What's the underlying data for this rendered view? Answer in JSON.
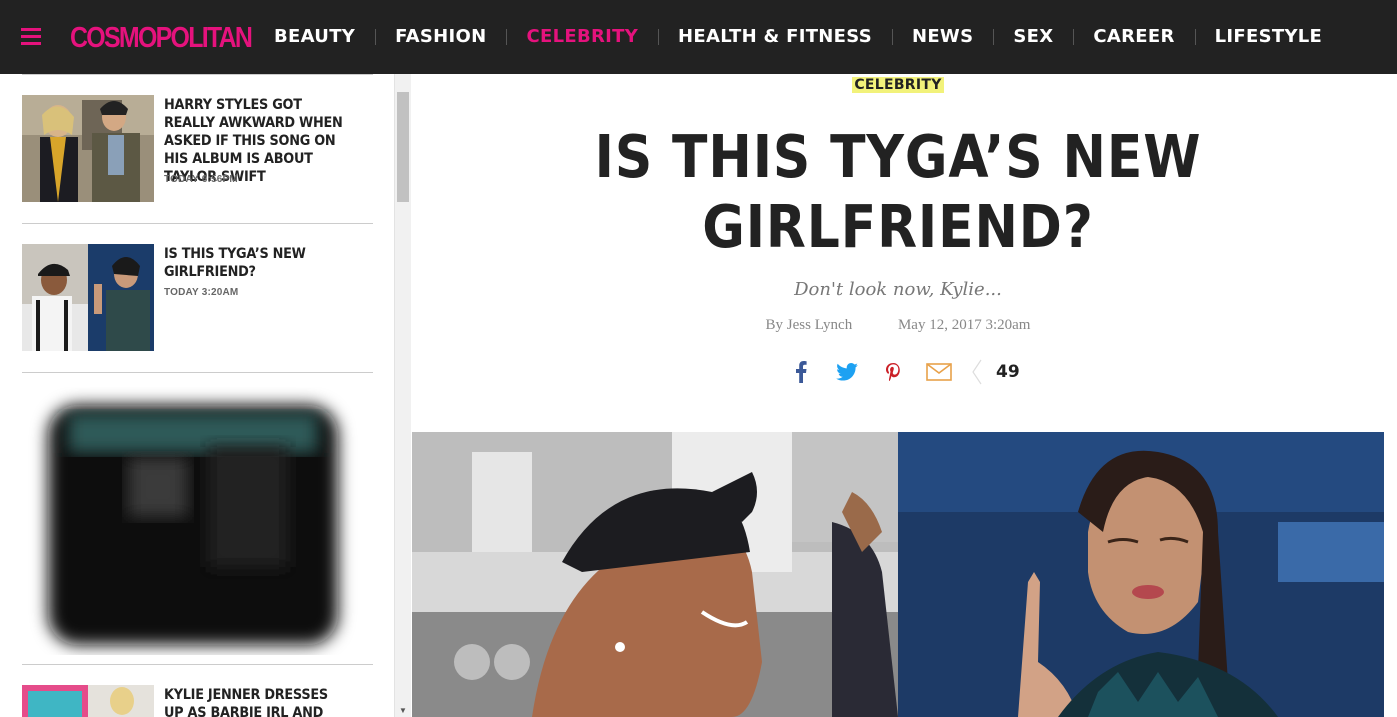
{
  "header": {
    "logo": "COSMOPOLITAN",
    "nav": [
      "BEAUTY",
      "FASHION",
      "CELEBRITY",
      "HEALTH & FITNESS",
      "NEWS",
      "SEX",
      "CAREER",
      "LIFESTYLE"
    ],
    "active": "CELEBRITY"
  },
  "sidebar": {
    "items": [
      {
        "title": "HARRY STYLES GOT REALLY AWKWARD WHEN ASKED IF THIS SONG ON HIS ALBUM IS ABOUT TAYLOR SWIFT",
        "time": "TODAY 6:56PM"
      },
      {
        "title": "IS THIS TYGA’S NEW GIRLFRIEND?",
        "time": "TODAY 3:20AM"
      },
      {
        "title": "KYLIE JENNER DRESSES UP AS BARBIE IRL AND THE PICS ARE",
        "time": ""
      }
    ]
  },
  "article": {
    "section": "CELEBRITY",
    "headline_line1": "IS THIS TYGA’S NEW",
    "headline_line2": "GIRLFRIEND?",
    "dek": "Don't look now, Kylie...",
    "author": "By Jess Lynch",
    "date": "May 12, 2017 3:20am",
    "share_count": "49"
  },
  "icons": {
    "facebook": "facebook-icon",
    "twitter": "twitter-icon",
    "pinterest": "pinterest-icon",
    "email": "email-icon"
  },
  "colors": {
    "brand": "#e5127d",
    "nav_bg": "#222222",
    "section_highlight": "#f2f27a",
    "facebook": "#3b5998",
    "twitter": "#1da1f2",
    "pinterest": "#cb2027",
    "email": "#e8a14a"
  }
}
